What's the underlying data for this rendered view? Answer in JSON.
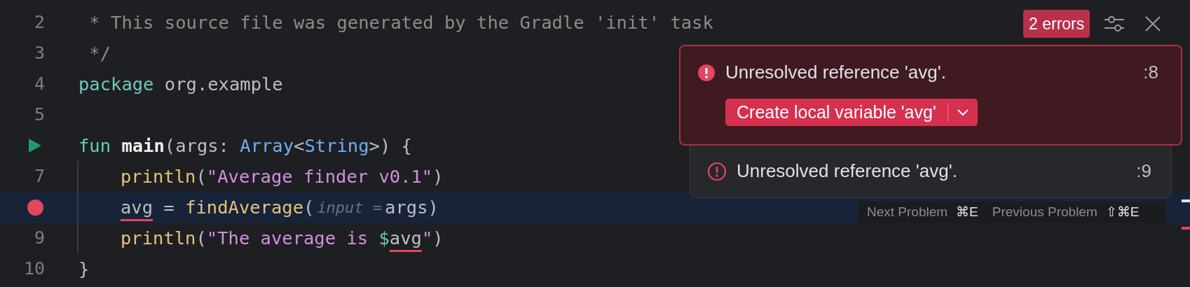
{
  "editor": {
    "lines": [
      {
        "number": "2",
        "kind": "numbered",
        "current": false,
        "indent": false,
        "tokens": [
          {
            "kind": "comment",
            "text": " * This source file was generated by the Gradle 'init' task",
            "error": false
          }
        ]
      },
      {
        "number": "3",
        "kind": "numbered",
        "current": false,
        "indent": false,
        "tokens": [
          {
            "kind": "comment",
            "text": " */",
            "error": false
          }
        ]
      },
      {
        "number": "4",
        "kind": "numbered",
        "current": false,
        "indent": false,
        "tokens": [
          {
            "kind": "keyword",
            "text": "package",
            "error": false
          },
          {
            "kind": "plain",
            "text": " org.example",
            "error": false
          }
        ]
      },
      {
        "number": "5",
        "kind": "numbered",
        "current": false,
        "indent": false
      },
      {
        "kind": "run",
        "current": false,
        "indent": false,
        "tokens": [
          {
            "kind": "keyword",
            "text": "fun",
            "error": false
          },
          {
            "kind": "declaration",
            "text": " main",
            "error": false
          },
          {
            "kind": "plain",
            "text": "(args: ",
            "error": false
          },
          {
            "kind": "type",
            "text": "Array",
            "error": false
          },
          {
            "kind": "plain",
            "text": "<",
            "error": false
          },
          {
            "kind": "type",
            "text": "String",
            "error": false
          },
          {
            "kind": "plain",
            "text": ">) {",
            "error": false
          }
        ]
      },
      {
        "number": "7",
        "kind": "numbered",
        "current": false,
        "indent": true,
        "tokens": [
          {
            "kind": "function",
            "text": "println",
            "error": false
          },
          {
            "kind": "plain",
            "text": "(",
            "error": false
          },
          {
            "kind": "string",
            "text": "\"Average finder v0.1\"",
            "error": false
          },
          {
            "kind": "plain",
            "text": ")",
            "error": false
          }
        ]
      },
      {
        "kind": "breakpoint",
        "current": true,
        "indent": true,
        "tokens": [
          {
            "kind": "plain",
            "text": "avg",
            "error": true
          },
          {
            "kind": "plain",
            "text": " = ",
            "error": false
          },
          {
            "kind": "function",
            "text": "findAverage",
            "error": false
          },
          {
            "kind": "plain",
            "text": "(",
            "error": false
          },
          {
            "kind": "hint",
            "text": "input =",
            "error": false
          },
          {
            "kind": "plain",
            "text": "args)",
            "error": false
          }
        ]
      },
      {
        "number": "9",
        "kind": "numbered",
        "current": false,
        "indent": true,
        "tokens": [
          {
            "kind": "function",
            "text": "println",
            "error": false
          },
          {
            "kind": "plain",
            "text": "(",
            "error": false
          },
          {
            "kind": "string",
            "text": "\"The average is ",
            "error": false
          },
          {
            "kind": "template",
            "text": "$",
            "error": false
          },
          {
            "kind": "plain",
            "text": "avg",
            "error": true
          },
          {
            "kind": "string",
            "text": "\"",
            "error": false
          },
          {
            "kind": "plain",
            "text": ")",
            "error": false
          }
        ]
      },
      {
        "number": "10",
        "kind": "numbered",
        "current": false,
        "indent": false,
        "tokens": [
          {
            "kind": "plain",
            "text": "}",
            "error": false
          }
        ]
      }
    ]
  },
  "problems": {
    "badge": "2 errors",
    "items": [
      {
        "message": "Unresolved reference 'avg'.",
        "line": ":8",
        "selected": true,
        "action": "Create local variable 'avg'"
      },
      {
        "message": "Unresolved reference 'avg'.",
        "line": ":9",
        "selected": false
      }
    ],
    "shortcuts": [
      {
        "label": "Next Problem",
        "keys": "⌘E"
      },
      {
        "label": "Previous Problem",
        "keys": "⇧⌘E"
      }
    ]
  }
}
